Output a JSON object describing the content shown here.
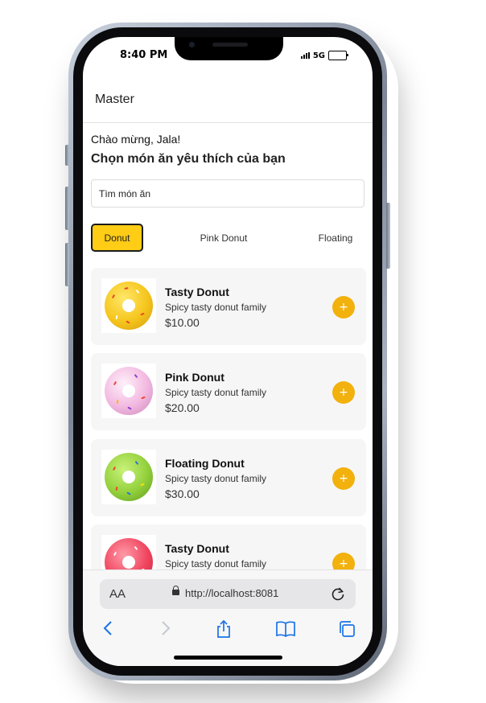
{
  "status_bar": {
    "time": "8:40 PM",
    "network": "5G"
  },
  "appbar": {
    "title": "Master"
  },
  "greeting": "Chào mừng, Jala!",
  "subtitle": "Chọn món ăn yêu thích của bạn",
  "search": {
    "value": "Tìm món ăn"
  },
  "tabs": [
    {
      "label": "Donut",
      "active": true
    },
    {
      "label": "Pink Donut",
      "active": false
    },
    {
      "label": "Floating",
      "active": false
    }
  ],
  "items": [
    {
      "name": "Tasty Donut",
      "description": "Spicy tasty donut family",
      "price": "$10.00",
      "icon": "yellow-donut"
    },
    {
      "name": "Pink Donut",
      "description": "Spicy tasty donut family",
      "price": "$20.00",
      "icon": "pink-donut"
    },
    {
      "name": "Floating Donut",
      "description": "Spicy tasty donut family",
      "price": "$30.00",
      "icon": "green-donut"
    },
    {
      "name": "Tasty Donut",
      "description": "Spicy tasty donut family",
      "price": "",
      "icon": "red-donut"
    }
  ],
  "add_label": "+",
  "safari": {
    "text_size": "AA",
    "url": "http://localhost:8081"
  },
  "colors": {
    "accent": "#ffcc16",
    "add_button": "#f2b10c",
    "safari_blue": "#1a73e8"
  }
}
